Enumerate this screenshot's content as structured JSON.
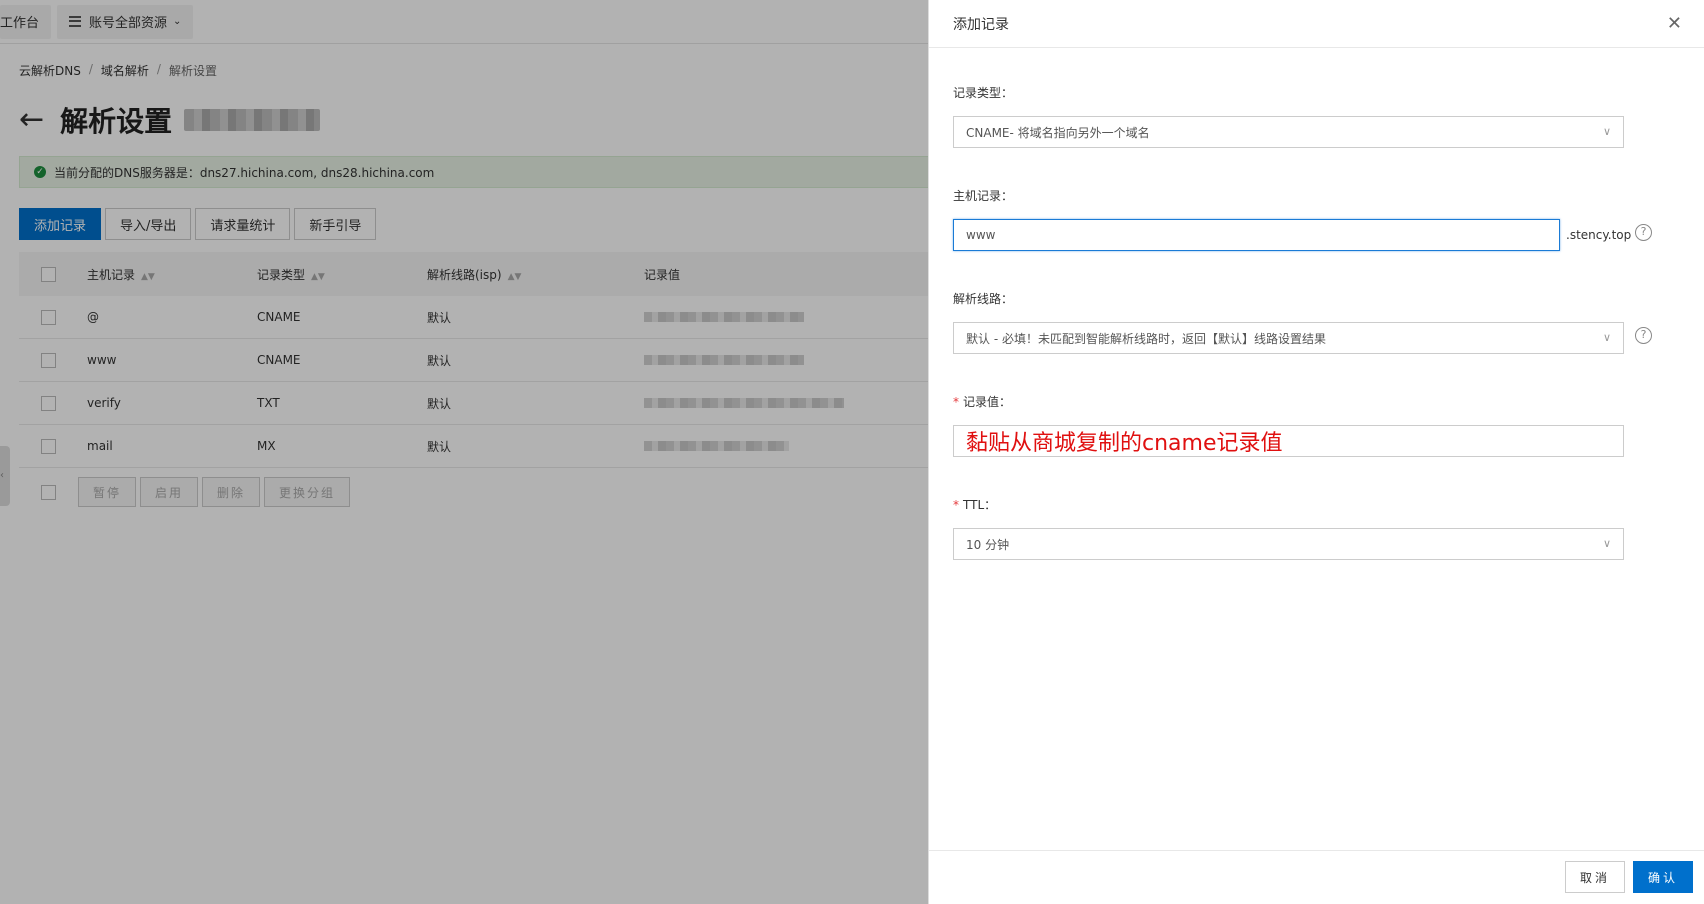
{
  "topbar": {
    "workbench": "工作台",
    "resources": "账号全部资源"
  },
  "breadcrumb": [
    "云解析DNS",
    "域名解析",
    "解析设置"
  ],
  "page": {
    "title": "解析设置"
  },
  "notice": {
    "text": "当前分配的DNS服务器是：dns27.hichina.com, dns28.hichina.com"
  },
  "actions": {
    "add": "添加记录",
    "import_export": "导入/导出",
    "stats": "请求量统计",
    "guide": "新手引导"
  },
  "table": {
    "headers": [
      "主机记录",
      "记录类型",
      "解析线路(isp)",
      "记录值"
    ],
    "rows": [
      {
        "host": "@",
        "type": "CNAME",
        "line": "默认"
      },
      {
        "host": "www",
        "type": "CNAME",
        "line": "默认"
      },
      {
        "host": "verify",
        "type": "TXT",
        "line": "默认"
      },
      {
        "host": "mail",
        "type": "MX",
        "line": "默认"
      }
    ],
    "footer_buttons": [
      "暂停",
      "启用",
      "删除",
      "更换分组"
    ]
  },
  "drawer": {
    "title": "添加记录",
    "record_type_label": "记录类型：",
    "record_type_value": "CNAME- 将域名指向另外一个域名",
    "host_label": "主机记录：",
    "host_value": "www",
    "host_suffix": ".stency.top",
    "line_label": "解析线路：",
    "line_value": "默认 - 必填！未匹配到智能解析线路时，返回【默认】线路设置结果",
    "value_label": "记录值：",
    "value_annotation": "黏贴从商城复制的cname记录值",
    "ttl_label": "TTL：",
    "ttl_value": "10 分钟",
    "cancel": "取消",
    "confirm": "确认"
  },
  "colors": {
    "primary": "#0070cc",
    "annotation": "#e01010",
    "focus": "#1a7bd6"
  }
}
